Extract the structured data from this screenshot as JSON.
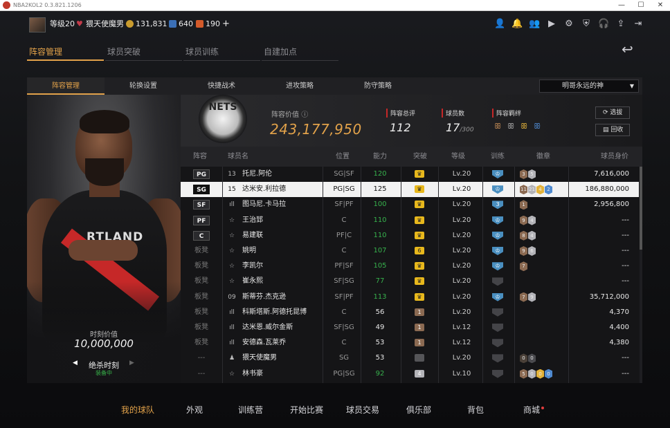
{
  "window": {
    "title": "NBA2KOL2 0.3.821.1206"
  },
  "topbar": {
    "level": "等级20",
    "username": "猥天使魔男",
    "coins": "131,831",
    "stars": "640",
    "points": "190",
    "plus": "+"
  },
  "main_tabs": [
    {
      "label": "阵容管理",
      "active": true
    },
    {
      "label": "球员突破",
      "active": false
    },
    {
      "label": "球员训练",
      "active": false
    },
    {
      "label": "自建加点",
      "active": false
    }
  ],
  "sub_tabs": [
    {
      "label": "阵容管理",
      "active": true
    },
    {
      "label": "轮换设置",
      "active": false
    },
    {
      "label": "快捷战术",
      "active": false
    },
    {
      "label": "进攻策略",
      "active": false
    },
    {
      "label": "防守策略",
      "active": false
    }
  ],
  "lineup_select": {
    "value": "明哥永远的神"
  },
  "player_card": {
    "jersey_text": "RTLAND",
    "value_label": "时刻价值",
    "value": "10,000,000",
    "skill_name": "绝杀时刻",
    "skill_status": "装备中"
  },
  "summary": {
    "team_logo_text": "NETS",
    "team_value_label": "阵容价值",
    "team_value": "243,177,950",
    "rating_label": "阵容总评",
    "rating": "112",
    "count_label": "球员数",
    "count": "17",
    "count_max": "/300",
    "bond_label": "阵容羁绊",
    "btn_select": "选拔",
    "btn_recycle": "回收"
  },
  "table": {
    "headers": {
      "lineup": "阵容",
      "name": "球员名",
      "position": "位置",
      "ability": "能力",
      "breakthrough": "突破",
      "level": "等级",
      "training": "训练",
      "badges": "徽章",
      "value": "球员身价"
    },
    "rows": [
      {
        "slot": "PG",
        "icon": "13",
        "name": "托尼.阿伦",
        "pos": "SG|SF",
        "ovr": "120",
        "ovr_color": "#37b24d",
        "brk": "♛",
        "brk_color": "#e8b81c",
        "lv": "Lv.20",
        "train": "♔",
        "train_color": "#4a8fc0",
        "badges": [
          {
            "t": "3",
            "c": "#8b6a52"
          },
          {
            "t": "5",
            "c": "#b3b3b8"
          }
        ],
        "val": "7,616,000"
      },
      {
        "slot": "SG",
        "icon": "15",
        "name": "达米安.利拉德",
        "pos": "PG|SG",
        "ovr": "125",
        "ovr_color": "#111111",
        "brk": "♛",
        "brk_color": "#e8b81c",
        "lv": "Lv.20",
        "train": "♔",
        "train_color": "#4a8fc0",
        "badges": [
          {
            "t": "11",
            "c": "#8b6a52"
          },
          {
            "t": "21",
            "c": "#b3b3b8"
          },
          {
            "t": "4",
            "c": "#e2b23a"
          },
          {
            "t": "2",
            "c": "#4f8ad0"
          }
        ],
        "val": "186,880,000",
        "selected": true
      },
      {
        "slot": "SF",
        "icon": "ıll",
        "name": "图马尼.卡马拉",
        "pos": "SF|PF",
        "ovr": "100",
        "ovr_color": "#37b24d",
        "brk": "♛",
        "brk_color": "#e8b81c",
        "lv": "Lv.20",
        "train": "3",
        "train_color": "#4a8fc0",
        "badges": [
          {
            "t": "1",
            "c": "#8b6a52"
          }
        ],
        "val": "2,956,800"
      },
      {
        "slot": "PF",
        "icon": "☆",
        "name": "王治郅",
        "pos": "C",
        "ovr": "110",
        "ovr_color": "#37b24d",
        "brk": "♛",
        "brk_color": "#e8b81c",
        "lv": "Lv.20",
        "train": "♔",
        "train_color": "#4a8fc0",
        "badges": [
          {
            "t": "9",
            "c": "#8b6a52"
          },
          {
            "t": "4",
            "c": "#b3b3b8"
          }
        ],
        "val": "---"
      },
      {
        "slot": "C",
        "icon": "☆",
        "name": "易建联",
        "pos": "PF|C",
        "ovr": "110",
        "ovr_color": "#37b24d",
        "brk": "♛",
        "brk_color": "#e8b81c",
        "lv": "Lv.20",
        "train": "♔",
        "train_color": "#4a8fc0",
        "badges": [
          {
            "t": "8",
            "c": "#8b6a52"
          },
          {
            "t": "4",
            "c": "#b3b3b8"
          }
        ],
        "val": "---"
      },
      {
        "slot": "板凳",
        "icon": "☆",
        "name": "姚明",
        "pos": "C",
        "ovr": "107",
        "ovr_color": "#37b24d",
        "brk": "6",
        "brk_color": "#e8b81c",
        "lv": "Lv.20",
        "train": "♔",
        "train_color": "#4a8fc0",
        "badges": [
          {
            "t": "9",
            "c": "#8b6a52"
          },
          {
            "t": "6",
            "c": "#b3b3b8"
          }
        ],
        "val": "---"
      },
      {
        "slot": "板凳",
        "icon": "☆",
        "name": "李凯尔",
        "pos": "PF|SF",
        "ovr": "105",
        "ovr_color": "#37b24d",
        "brk": "♛",
        "brk_color": "#e8b81c",
        "lv": "Lv.20",
        "train": "♔",
        "train_color": "#4a8fc0",
        "badges": [
          {
            "t": "7",
            "c": "#8b6a52"
          }
        ],
        "val": "---"
      },
      {
        "slot": "板凳",
        "icon": "☆",
        "name": "崔永熙",
        "pos": "SF|SG",
        "ovr": "77",
        "ovr_color": "#37b24d",
        "brk": "♛",
        "brk_color": "#e8b81c",
        "lv": "Lv.20",
        "train": "",
        "train_color": "#444448",
        "badges": [],
        "val": "---"
      },
      {
        "slot": "板凳",
        "icon": "09",
        "name": "斯蒂芬.杰克逊",
        "pos": "SF|PF",
        "ovr": "113",
        "ovr_color": "#37b24d",
        "brk": "♛",
        "brk_color": "#e8b81c",
        "lv": "Lv.20",
        "train": "♔",
        "train_color": "#4a8fc0",
        "badges": [
          {
            "t": "7",
            "c": "#8b6a52"
          },
          {
            "t": "9",
            "c": "#b3b3b8"
          }
        ],
        "val": "35,712,000"
      },
      {
        "slot": "板凳",
        "icon": "ıll",
        "name": "科斯塔斯.阿德托昆博",
        "pos": "C",
        "ovr": "56",
        "ovr_color": "#e8e8e8",
        "brk": "1",
        "brk_color": "#8b6a52",
        "lv": "Lv.20",
        "train": "",
        "train_color": "#444448",
        "badges": [],
        "val": "4,370"
      },
      {
        "slot": "板凳",
        "icon": "ıll",
        "name": "达米恩.威尔金斯",
        "pos": "SF|SG",
        "ovr": "49",
        "ovr_color": "#e8e8e8",
        "brk": "1",
        "brk_color": "#8b6a52",
        "lv": "Lv.12",
        "train": "",
        "train_color": "#444448",
        "badges": [],
        "val": "4,400"
      },
      {
        "slot": "板凳",
        "icon": "ıll",
        "name": "安德森.瓦莱乔",
        "pos": "C",
        "ovr": "53",
        "ovr_color": "#e8e8e8",
        "brk": "1",
        "brk_color": "#8b6a52",
        "lv": "Lv.12",
        "train": "",
        "train_color": "#444448",
        "badges": [],
        "val": "4,380"
      },
      {
        "slot": "---",
        "icon": "♟",
        "name": "猥天使魔男",
        "pos": "SG",
        "ovr": "53",
        "ovr_color": "#e8e8e8",
        "brk": "",
        "brk_color": "#555558",
        "lv": "Lv.20",
        "train": "",
        "train_color": "#444448",
        "badges": [
          {
            "t": "0",
            "c": "#4a4038"
          },
          {
            "t": "0",
            "c": "#4a4a4e"
          }
        ],
        "val": "---"
      },
      {
        "slot": "---",
        "icon": "☆",
        "name": "林书豪",
        "pos": "PG|SG",
        "ovr": "92",
        "ovr_color": "#37b24d",
        "brk": "4",
        "brk_color": "#b3b3b8",
        "lv": "Lv.10",
        "train": "",
        "train_color": "#444448",
        "badges": [
          {
            "t": "5",
            "c": "#8b6a52"
          },
          {
            "t": "0",
            "c": "#b3b3b8"
          },
          {
            "t": "0",
            "c": "#e2b23a"
          },
          {
            "t": "0",
            "c": "#4f8ad0"
          }
        ],
        "val": "---"
      }
    ]
  },
  "bottom_nav": [
    {
      "label": "我的球队",
      "active": true
    },
    {
      "label": "外观",
      "active": false
    },
    {
      "label": "训练营",
      "active": false
    },
    {
      "label": "开始比赛",
      "active": false
    },
    {
      "label": "球员交易",
      "active": false
    },
    {
      "label": "俱乐部",
      "active": false
    },
    {
      "label": "背包",
      "active": false
    },
    {
      "label": "商城",
      "active": false,
      "notify": true
    }
  ]
}
